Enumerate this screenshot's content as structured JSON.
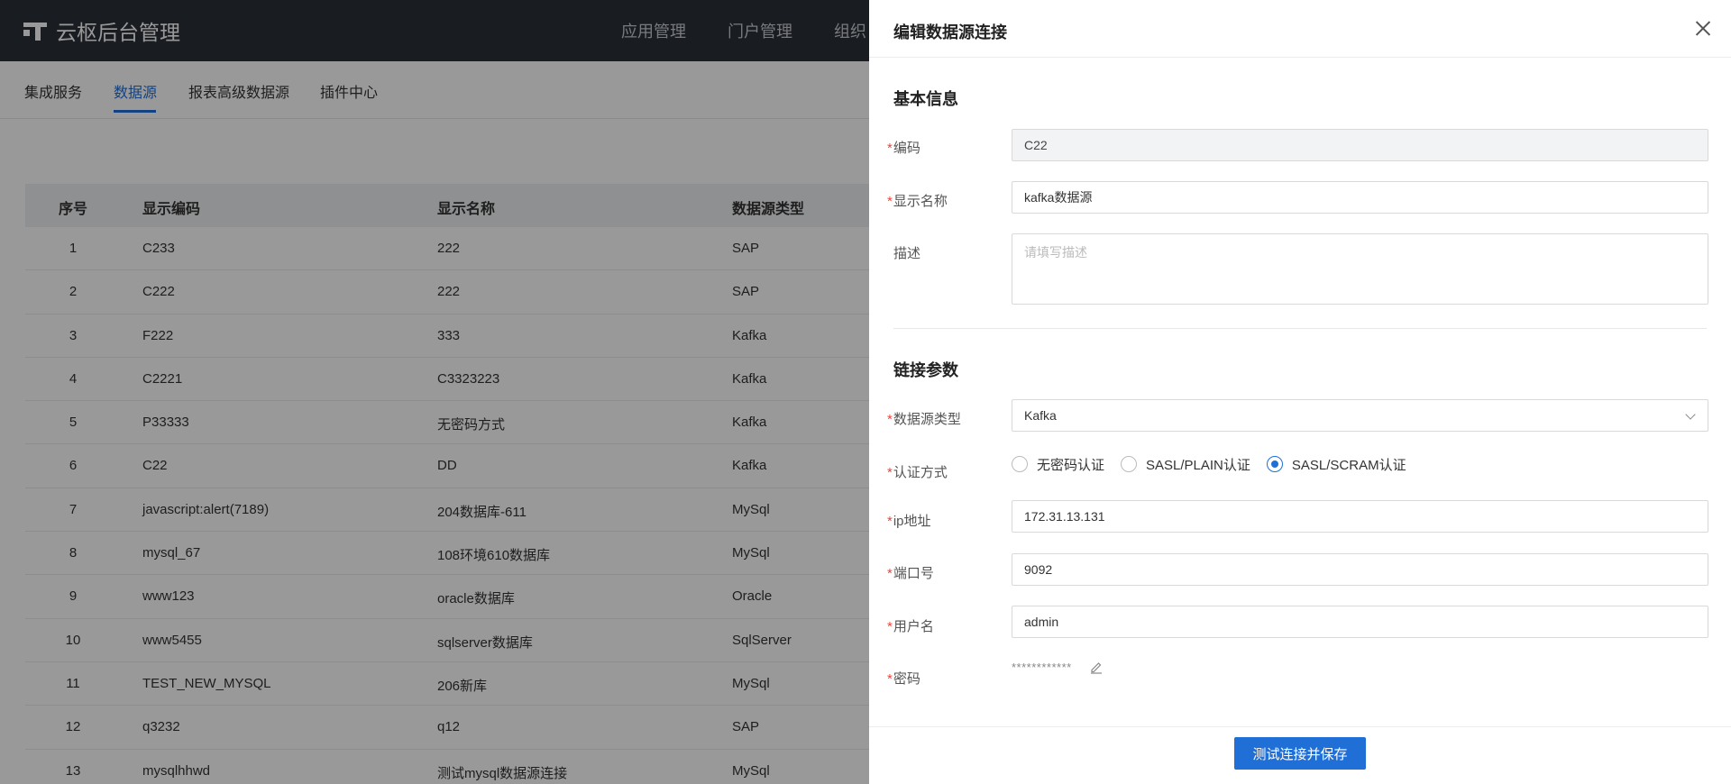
{
  "app": {
    "title": "云枢后台管理"
  },
  "topnav": {
    "items": [
      "应用管理",
      "门户管理",
      "组织"
    ]
  },
  "subtabs": {
    "items": [
      "集成服务",
      "数据源",
      "报表高级数据源",
      "插件中心"
    ],
    "active_index": 1
  },
  "table": {
    "headers": [
      "序号",
      "显示编码",
      "显示名称",
      "数据源类型"
    ],
    "rows": [
      [
        "1",
        "C233",
        "222",
        "SAP"
      ],
      [
        "2",
        "C222",
        "222",
        "SAP"
      ],
      [
        "3",
        "F222",
        "333",
        "Kafka"
      ],
      [
        "4",
        "C2221",
        "C3323223",
        "Kafka"
      ],
      [
        "5",
        "P33333",
        "无密码方式",
        "Kafka"
      ],
      [
        "6",
        "C22",
        "DD",
        "Kafka"
      ],
      [
        "7",
        "javascript:alert(7189)",
        "204数据库-611",
        "MySql"
      ],
      [
        "8",
        "mysql_67",
        "108环境610数据库",
        "MySql"
      ],
      [
        "9",
        "www123",
        "oracle数据库",
        "Oracle"
      ],
      [
        "10",
        "www5455",
        "sqlserver数据库",
        "SqlServer"
      ],
      [
        "11",
        "TEST_NEW_MYSQL",
        "206新库",
        "MySql"
      ],
      [
        "12",
        "q3232",
        "q12",
        "SAP"
      ],
      [
        "13",
        "mysqlhhwd",
        "测试mysql数据源连接",
        "MySql"
      ]
    ]
  },
  "drawer": {
    "title": "编辑数据源连接",
    "section_basic": "基本信息",
    "section_conn": "链接参数",
    "required_mark": "*",
    "code": {
      "label": "编码",
      "value": "C22"
    },
    "display_name": {
      "label": "显示名称",
      "value": "kafka数据源"
    },
    "description": {
      "label": "描述",
      "placeholder": "请填写描述"
    },
    "ds_type": {
      "label": "数据源类型",
      "value": "Kafka"
    },
    "auth": {
      "label": "认证方式",
      "options": [
        "无密码认证",
        "SASL/PLAIN认证",
        "SASL/SCRAM认证"
      ],
      "selected_index": 2
    },
    "ip": {
      "label": "ip地址",
      "value": "172.31.13.131"
    },
    "port": {
      "label": "端口号",
      "value": "9092"
    },
    "username": {
      "label": "用户名",
      "value": "admin"
    },
    "password": {
      "label": "密码",
      "value": "************"
    },
    "submit_label": "测试连接并保存"
  },
  "colors": {
    "accent": "#1f6fd6",
    "topbar": "#2b2f38",
    "required": "#e8453c"
  }
}
